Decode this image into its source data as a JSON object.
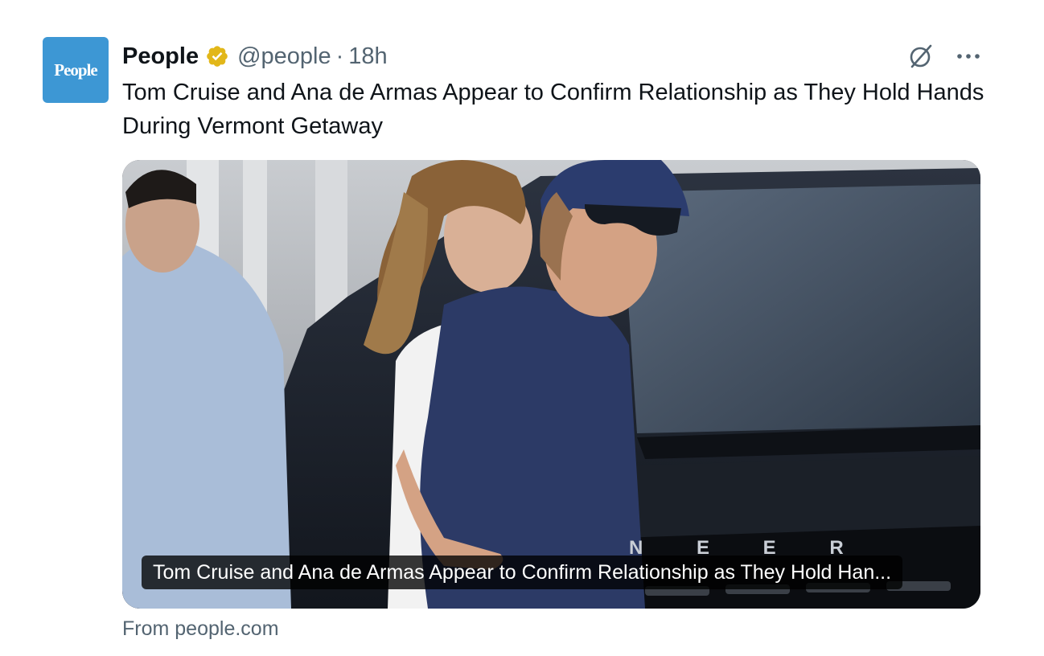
{
  "author": {
    "display_name": "People",
    "handle": "@people",
    "separator": "·",
    "time": "18h",
    "avatar_text": "People",
    "verified_badge": "gold-verified-badge-icon",
    "avatar_color": "#3d97d4",
    "badge_color": "#e2b719"
  },
  "tweet": {
    "text": "Tom Cruise and Ana de Armas Appear to Confirm Relationship as They Hold Hands During Vermont Getaway"
  },
  "media": {
    "caption": "Tom Cruise and Ana de Armas Appear to Confirm Relationship as They Hold Han...",
    "vehicle_lettering": "N E E R"
  },
  "card": {
    "source": "From people.com"
  },
  "actions": {
    "grok_icon": "slashed-circle-icon",
    "more_icon": "more-options-icon"
  }
}
